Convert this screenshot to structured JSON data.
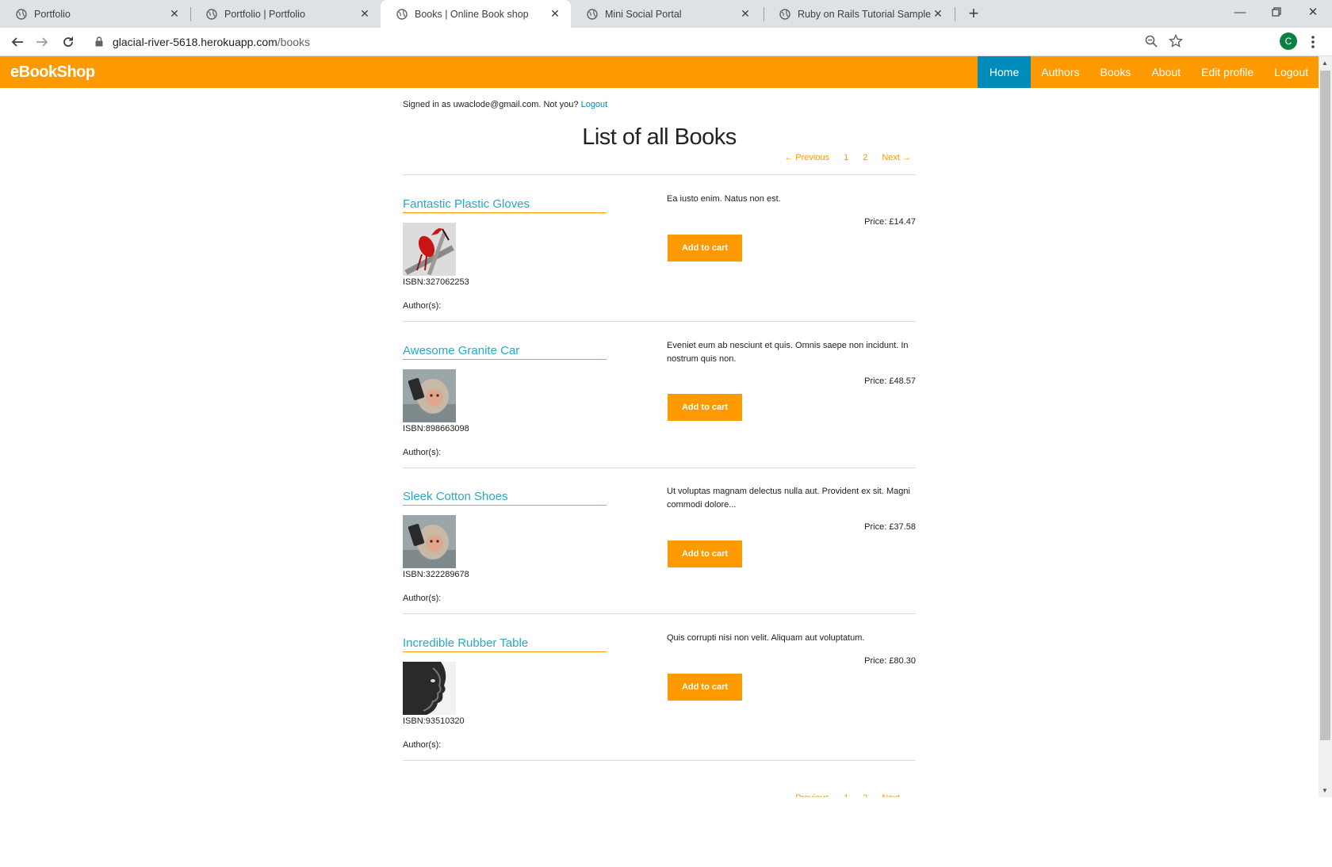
{
  "browser": {
    "tabs": [
      {
        "title": "Portfolio",
        "active": false
      },
      {
        "title": "Portfolio | Portfolio",
        "active": false
      },
      {
        "title": "Books | Online Book shop",
        "active": true
      },
      {
        "title": "Mini Social Portal",
        "active": false
      },
      {
        "title": "Ruby on Rails Tutorial Sample Ap",
        "active": false
      }
    ],
    "url_host": "glacial-river-5618.herokuapp.com",
    "url_path": "/books",
    "profile_initial": "C"
  },
  "site": {
    "brand": "eBookShop",
    "nav": [
      "Home",
      "Authors",
      "Books",
      "About",
      "Edit profile",
      "Logout"
    ],
    "accent_color": "#ff9900",
    "active_nav_color": "#008cba"
  },
  "session": {
    "signed_in_text": "Signed in as uwaclode@gmail.com. Not you?",
    "logout_link": "Logout"
  },
  "page": {
    "title": "List of all Books",
    "pager": {
      "previous": "← Previous",
      "pages": [
        "1",
        "2"
      ],
      "next": "Next →"
    }
  },
  "books": [
    {
      "title": "Fantastic Plastic Gloves",
      "isbn": "ISBN:327062253",
      "authors_label": "Author(s):",
      "description": "Ea iusto enim. Natus non est.",
      "price": "Price: £14.47",
      "cart_label": "Add to cart",
      "image": "red-bird"
    },
    {
      "title": "Awesome Granite Car",
      "isbn": "ISBN:898663098",
      "authors_label": "Author(s):",
      "description": "Eveniet eum ab nesciunt et quis. Omnis saepe non incidunt. In nostrum quis non.",
      "price": "Price: £48.57",
      "cart_label": "Add to cart",
      "image": "monkey-phone"
    },
    {
      "title": "Sleek Cotton Shoes",
      "isbn": "ISBN:322289678",
      "authors_label": "Author(s):",
      "description": "Ut voluptas magnam delectus nulla aut. Provident ex sit. Magni commodi dolore...",
      "price": "Price: £37.58",
      "cart_label": "Add to cart",
      "image": "monkey-phone"
    },
    {
      "title": "Incredible Rubber Table",
      "isbn": "ISBN:93510320",
      "authors_label": "Author(s):",
      "description": "Quis corrupti nisi non velit. Aliquam aut voluptatum.",
      "price": "Price: £80.30",
      "cart_label": "Add to cart",
      "image": "face-profile"
    }
  ]
}
